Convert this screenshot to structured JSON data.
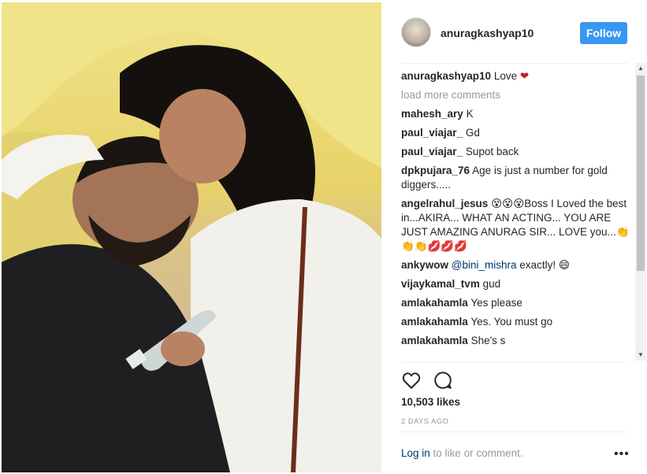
{
  "post": {
    "author": "anuragkashyap10",
    "follow_label": "Follow",
    "caption": "Love",
    "caption_emoji": "❤"
  },
  "comments": {
    "load_more": "load more comments",
    "items": [
      {
        "user": "mahesh_ary",
        "text": "K"
      },
      {
        "user": "paul_viajar_",
        "text": "Gd"
      },
      {
        "user": "paul_viajar_",
        "text": "Supot back"
      },
      {
        "user": "dpkpujara_76",
        "text": "Age is just a number for gold diggers....."
      },
      {
        "user": "angelrahul_jesus",
        "text": "😵😵😵Boss I Loved the best in...AKIRA... WHAT AN ACTING... YOU ARE JUST AMAZING ANURAG SIR... LOVE you...👏👏👏💋💋💋"
      },
      {
        "user": "ankywow",
        "mention": "@bini_mishra",
        "text": "exactly! 😄"
      },
      {
        "user": "vijaykamal_tvm",
        "text": "gud"
      },
      {
        "user": "amlakahamla",
        "text": "Yes please"
      },
      {
        "user": "amlakahamla",
        "text": "Yes. You must go"
      },
      {
        "user": "amlakahamla",
        "text": "She's s"
      }
    ]
  },
  "actions": {
    "like_icon": "heart-outline-icon",
    "comment_icon": "comment-bubble-icon"
  },
  "likes": "10,503 likes",
  "timestamp": "2 DAYS AGO",
  "footer": {
    "login_link": "Log in",
    "login_rest": " to like or comment.",
    "more_label": "•••"
  },
  "colors": {
    "accent": "#3897f0",
    "link": "#003569",
    "muted": "#999999"
  }
}
